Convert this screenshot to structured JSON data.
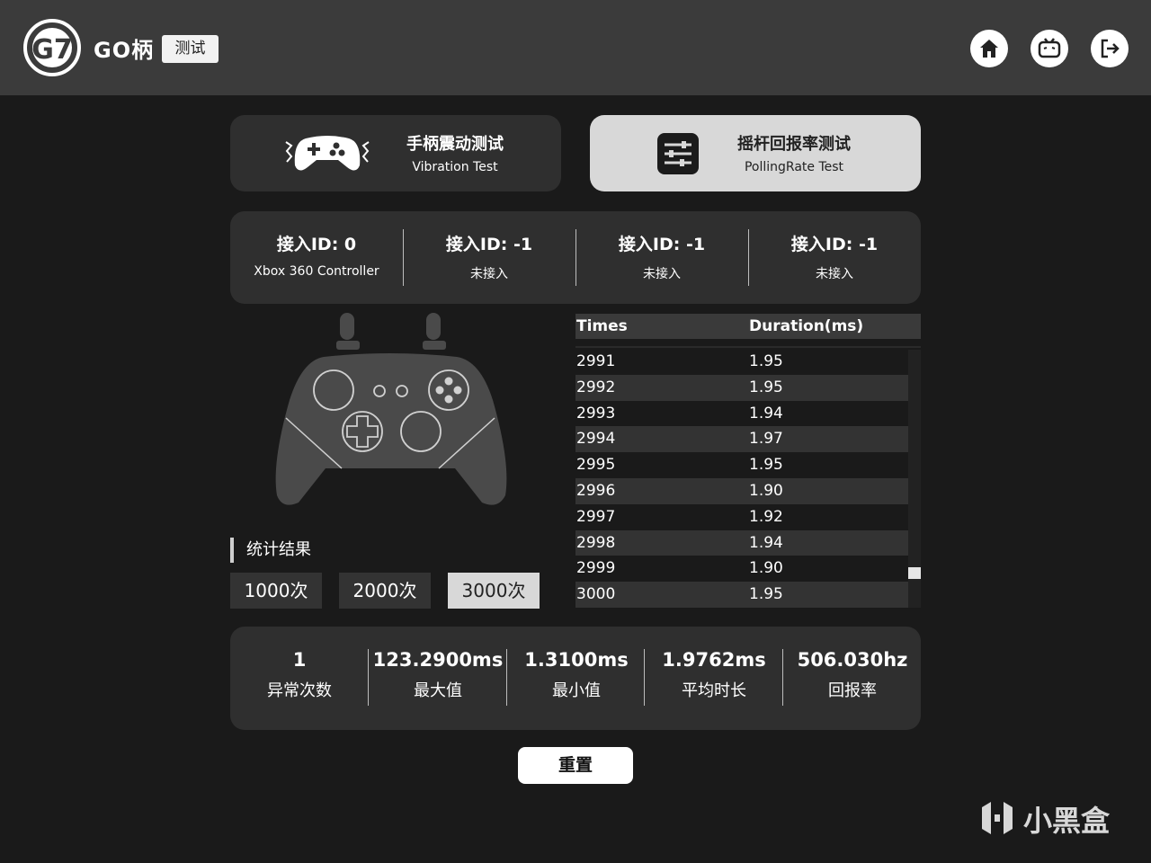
{
  "header": {
    "brand": "GO柄",
    "tag": "测试"
  },
  "modes": [
    {
      "title": "手柄震动测试",
      "subtitle": "Vibration Test"
    },
    {
      "title": "摇杆回报率测试",
      "subtitle": "PollingRate Test"
    }
  ],
  "devices": [
    {
      "id": "接入ID: 0",
      "name": "Xbox 360 Controller"
    },
    {
      "id": "接入ID: -1",
      "name": "未接入"
    },
    {
      "id": "接入ID: -1",
      "name": "未接入"
    },
    {
      "id": "接入ID: -1",
      "name": "未接入"
    }
  ],
  "table": {
    "headers": [
      "Times",
      "Duration(ms)"
    ],
    "rows": [
      [
        "2991",
        "1.95"
      ],
      [
        "2992",
        "1.95"
      ],
      [
        "2993",
        "1.94"
      ],
      [
        "2994",
        "1.97"
      ],
      [
        "2995",
        "1.95"
      ],
      [
        "2996",
        "1.90"
      ],
      [
        "2997",
        "1.92"
      ],
      [
        "2998",
        "1.94"
      ],
      [
        "2999",
        "1.90"
      ],
      [
        "3000",
        "1.95"
      ]
    ]
  },
  "stats": {
    "label": "统计结果",
    "counts": [
      "1000次",
      "2000次",
      "3000次"
    ],
    "selected": "3000次"
  },
  "results": [
    {
      "value": "1",
      "label": "异常次数"
    },
    {
      "value": "123.2900ms",
      "label": "最大值"
    },
    {
      "value": "1.3100ms",
      "label": "最小值"
    },
    {
      "value": "1.9762ms",
      "label": "平均时长"
    },
    {
      "value": "506.030hz",
      "label": "回报率"
    }
  ],
  "reset_label": "重置",
  "watermark": "小黑盒",
  "colors": {
    "background": "#1a1a1a",
    "header": "#3b3b3b",
    "card": "#2f2f2f",
    "active_card": "#d8d8d8"
  }
}
